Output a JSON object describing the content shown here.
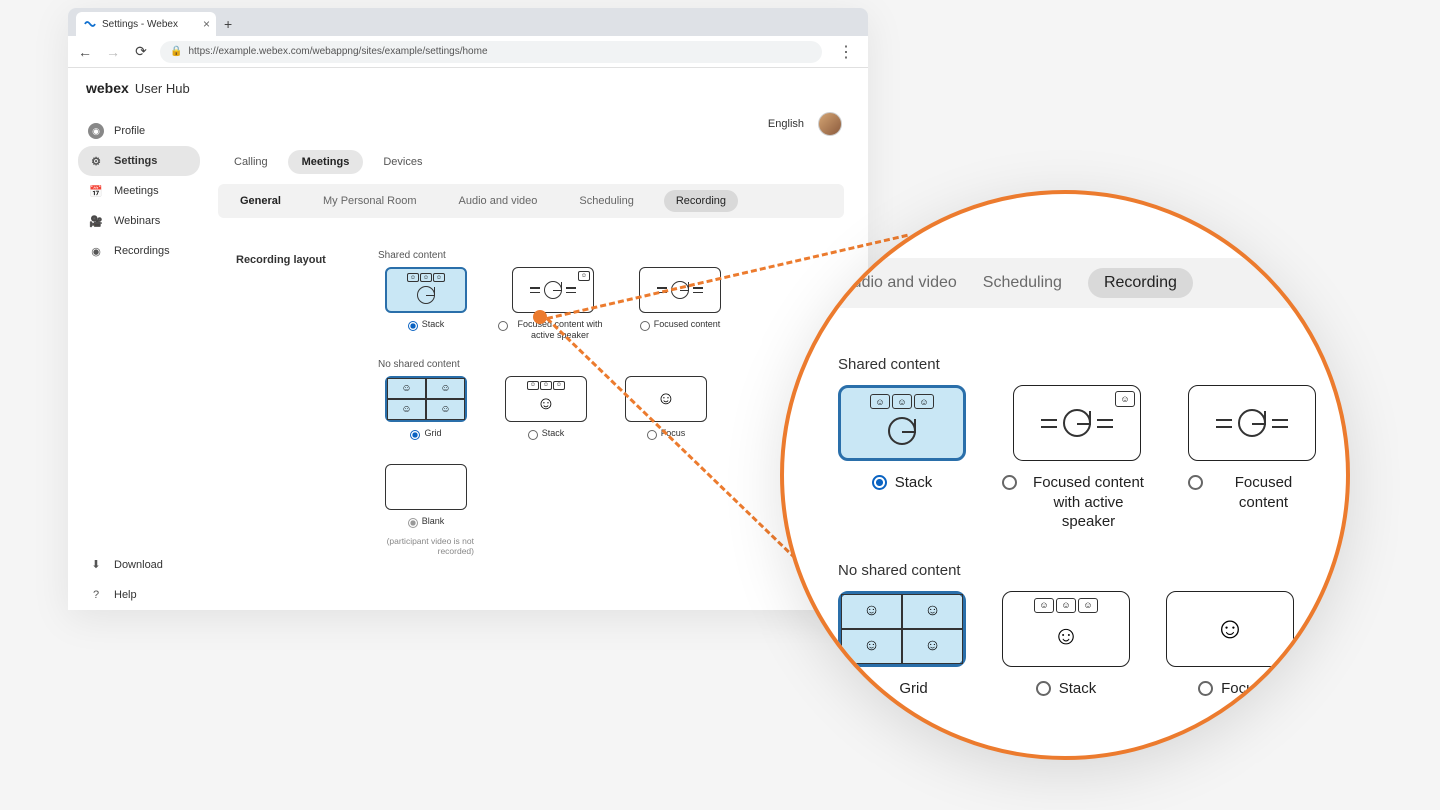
{
  "browser": {
    "tab_title": "Settings - Webex",
    "url": "https://example.webex.com/webappng/sites/example/settings/home"
  },
  "header": {
    "brand": "webex",
    "sub": "User Hub"
  },
  "top": {
    "language": "English"
  },
  "sidebar": {
    "items": [
      {
        "label": "Profile"
      },
      {
        "label": "Settings"
      },
      {
        "label": "Meetings"
      },
      {
        "label": "Webinars"
      },
      {
        "label": "Recordings"
      }
    ],
    "footer": [
      {
        "label": "Download"
      },
      {
        "label": "Help"
      }
    ]
  },
  "tabs": {
    "primary": [
      "Calling",
      "Meetings",
      "Devices"
    ],
    "secondary": [
      "General",
      "My Personal Room",
      "Audio and video",
      "Scheduling",
      "Recording"
    ]
  },
  "recording": {
    "section_title": "Recording layout",
    "shared_label": "Shared content",
    "no_shared_label": "No shared content",
    "shared_options": [
      "Stack",
      "Focused content with active speaker",
      "Focused content"
    ],
    "no_shared_options": [
      "Grid",
      "Stack",
      "Focus",
      "Blank"
    ],
    "blank_hint": "(participant video is not recorded)"
  },
  "zoom": {
    "tabs": [
      "Audio and video",
      "Scheduling",
      "Recording"
    ],
    "shared_label": "Shared content",
    "no_shared_label": "No shared content",
    "shared_options": [
      "Stack",
      "Focused content with active speaker",
      "Focused content"
    ],
    "no_shared_options": [
      "Grid",
      "Stack",
      "Focus"
    ]
  }
}
